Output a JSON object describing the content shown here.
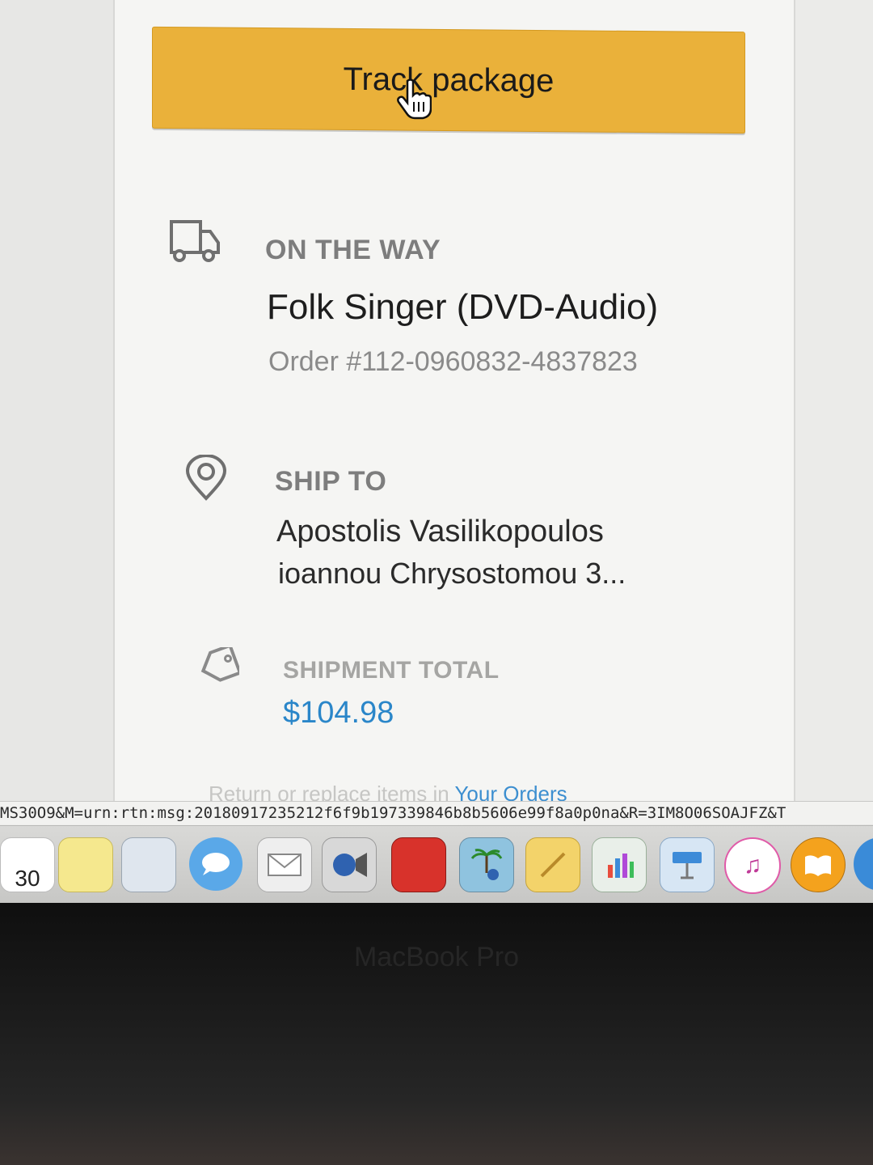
{
  "track_button": {
    "label": "Track package"
  },
  "status_section": {
    "label": "ON THE WAY",
    "product": "Folk Singer (DVD-Audio)",
    "order_number": "Order #112-0960832-4837823"
  },
  "ship_to": {
    "label": "SHIP TO",
    "name": "Apostolis Vasilikopoulos",
    "address": "ioannou Chrysostomou 3..."
  },
  "shipment_total": {
    "label": "SHIPMENT TOTAL",
    "amount": "$104.98"
  },
  "footer": {
    "prefix": "Return or replace items in",
    "link": "Your Orders"
  },
  "status_bar": {
    "url": "MS30O9&M=urn:rtn:msg:20180917235212f6f9b197339846b8b5606e99f8a0p0na&R=3IM8O06SOAJFZ&T"
  },
  "dock": {
    "calendar_day": "30",
    "items": [
      "calendar-icon",
      "notes-icon",
      "preview-icon",
      "messages-icon",
      "mail-icon",
      "facetime-icon",
      "photo-booth-icon",
      "iphoto-icon",
      "pages-icon",
      "numbers-icon",
      "keynote-icon",
      "itunes-icon",
      "ibooks-icon",
      "safari-icon"
    ]
  },
  "colors": {
    "button": "#eab13a",
    "price": "#2a86c9",
    "link": "#3d8fd0"
  },
  "bezel": {
    "label": "MacBook Pro"
  }
}
